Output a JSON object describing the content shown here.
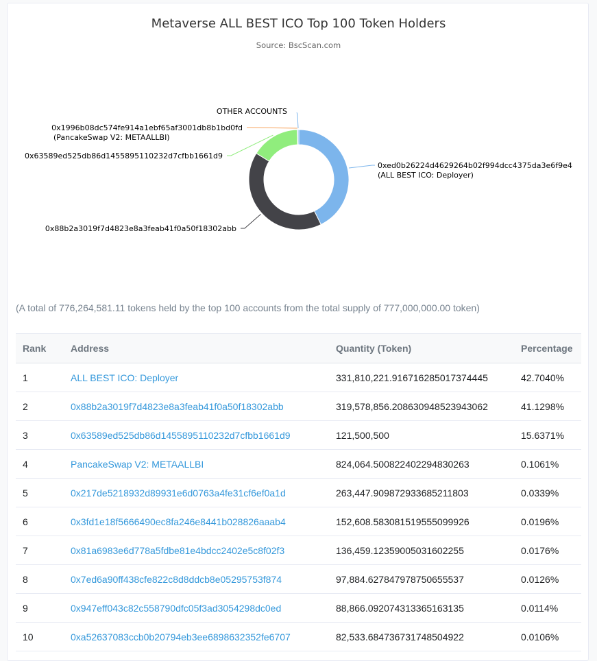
{
  "chart_data": {
    "type": "pie",
    "title": "Metaverse ALL BEST ICO Top 100 Token Holders",
    "subtitle": "Source: BscScan.com",
    "slices": [
      {
        "label": "0xed0b26224d4629264b02f994dcc4375da3e6f9e4",
        "sublabel": "(ALL BEST ICO: Deployer)",
        "value": 42.704,
        "color": "#7cb5ec"
      },
      {
        "label": "0x88b2a3019f7d4823e8a3feab41f0a50f18302abb",
        "sublabel": "",
        "value": 41.1298,
        "color": "#434348"
      },
      {
        "label": "0x63589ed525db86d1455895110232d7cfbb1661d9",
        "sublabel": "",
        "value": 15.6371,
        "color": "#90ed7d"
      },
      {
        "label": "0x1996b08dc574fe914a1ebf65af3001db8b1bd0fd",
        "sublabel": "(PancakeSwap V2: METAALLBI)",
        "value": 0.1061,
        "color": "#f7a35c"
      },
      {
        "label": "OTHER ACCOUNTS",
        "sublabel": "",
        "value": 0.4231,
        "color": "#7cb5ec"
      }
    ]
  },
  "summary": "(A total of 776,264,581.11 tokens held by the top 100 accounts from the total supply of 777,000,000.00 token)",
  "table": {
    "headers": {
      "rank": "Rank",
      "address": "Address",
      "quantity": "Quantity (Token)",
      "percentage": "Percentage"
    },
    "rows": [
      {
        "rank": "1",
        "address": "ALL BEST ICO: Deployer",
        "quantity": "331,810,221.916716285017374445",
        "percentage": "42.7040%"
      },
      {
        "rank": "2",
        "address": "0x88b2a3019f7d4823e8a3feab41f0a50f18302abb",
        "quantity": "319,578,856.208630948523943062",
        "percentage": "41.1298%"
      },
      {
        "rank": "3",
        "address": "0x63589ed525db86d1455895110232d7cfbb1661d9",
        "quantity": "121,500,500",
        "percentage": "15.6371%"
      },
      {
        "rank": "4",
        "address": "PancakeSwap V2: METAALLBI",
        "quantity": "824,064.500822402294830263",
        "percentage": "0.1061%"
      },
      {
        "rank": "5",
        "address": "0x217de5218932d89931e6d0763a4fe31cf6ef0a1d",
        "quantity": "263,447.909872933685211803",
        "percentage": "0.0339%"
      },
      {
        "rank": "6",
        "address": "0x3fd1e18f5666490ec8fa246e8441b028826aaab4",
        "quantity": "152,608.583081519555099926",
        "percentage": "0.0196%"
      },
      {
        "rank": "7",
        "address": "0x81a6983e6d778a5fdbe81e4bdcc2402e5c8f02f3",
        "quantity": "136,459.12359005031602255",
        "percentage": "0.0176%"
      },
      {
        "rank": "8",
        "address": "0x7ed6a90ff438cfe822c8d8ddcb8e05295753f874",
        "quantity": "97,884.627847978750655537",
        "percentage": "0.0126%"
      },
      {
        "rank": "9",
        "address": "0x947eff043c82c558790dfc05f3ad3054298dc0ed",
        "quantity": "88,866.092074313365163135",
        "percentage": "0.0114%"
      },
      {
        "rank": "10",
        "address": "0xa52637083ccb0b20794eb3ee6898632352fe6707",
        "quantity": "82,533.684736731748504922",
        "percentage": "0.0106%"
      }
    ]
  }
}
